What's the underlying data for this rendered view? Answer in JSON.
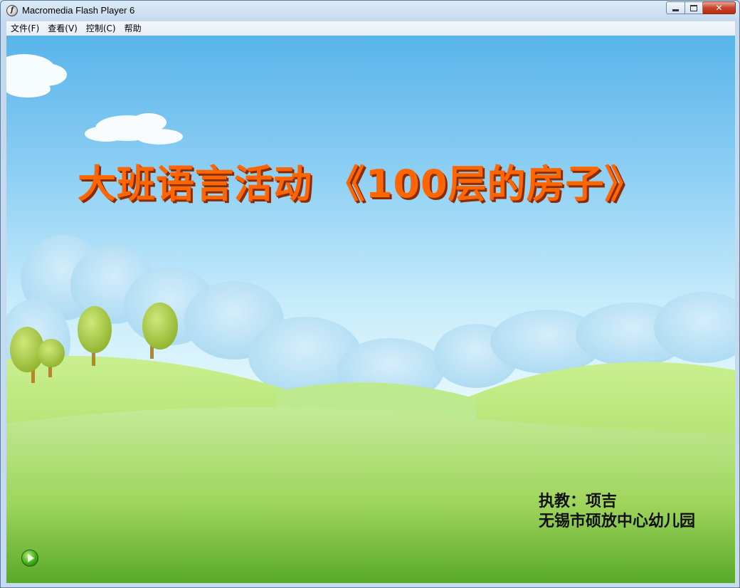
{
  "window": {
    "title": "Macromedia Flash Player 6",
    "icon": "flash-player-icon",
    "controls": [
      "minimize-icon",
      "maximize-icon",
      "close-icon"
    ]
  },
  "menubar": {
    "items": [
      "文件(F)",
      "查看(V)",
      "控制(C)",
      "帮助"
    ]
  },
  "slide": {
    "heading": "大班语言活动 《100层的房子》",
    "teacher_line": "执教：项吉",
    "school_line": "无锡市硕放中心幼儿园",
    "heading_color": "#ff6600",
    "play_icon": "play-icon"
  }
}
